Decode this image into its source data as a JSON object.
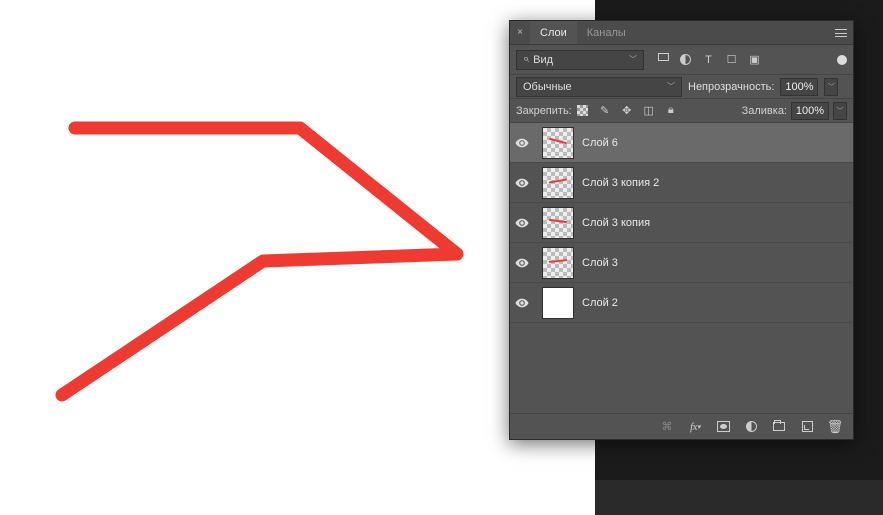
{
  "colors": {
    "stroke": "#ef3a32"
  },
  "tabs": {
    "layers": "Слои",
    "channels": "Каналы"
  },
  "filter": {
    "kind": "Вид"
  },
  "blend": {
    "mode": "Обычные",
    "opacity_label": "Непрозрачность:",
    "opacity_value": "100%"
  },
  "lock": {
    "label": "Закрепить:",
    "fill_label": "Заливка:",
    "fill_value": "100%"
  },
  "layers": [
    {
      "name": "Слой 6",
      "thumb": "trans-line",
      "selected": true
    },
    {
      "name": "Слой 3 копия 2",
      "thumb": "trans-line",
      "selected": false
    },
    {
      "name": "Слой 3 копия",
      "thumb": "trans-line",
      "selected": false
    },
    {
      "name": "Слой 3",
      "thumb": "trans-line",
      "selected": false
    },
    {
      "name": "Слой 2",
      "thumb": "solid-white",
      "selected": false
    }
  ]
}
